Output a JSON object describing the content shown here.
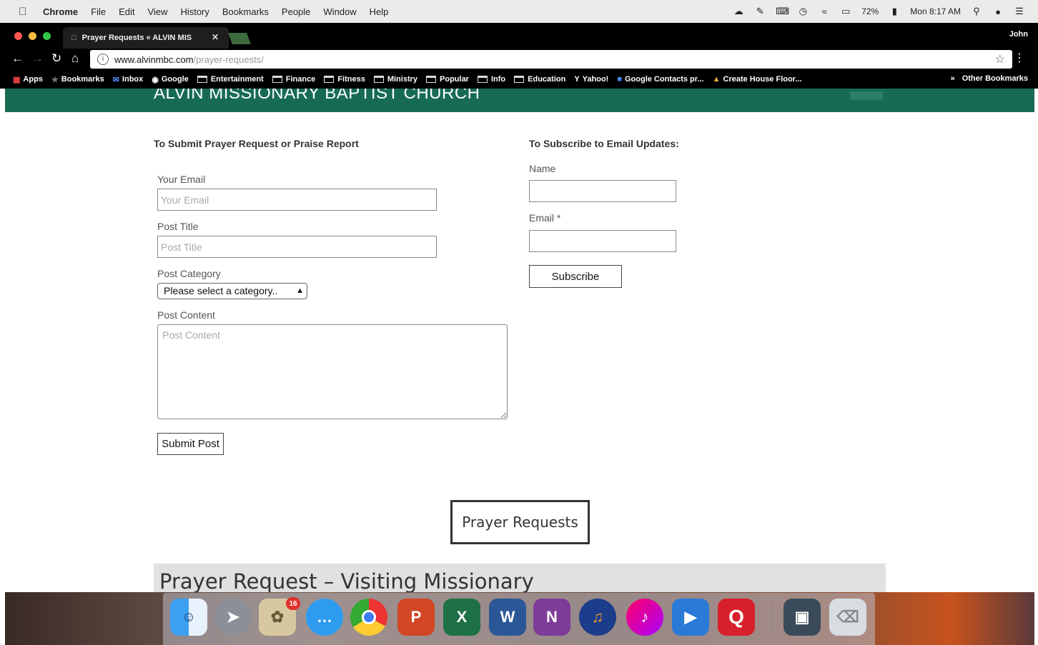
{
  "menubar": {
    "app_name": "Chrome",
    "items": [
      "File",
      "Edit",
      "View",
      "History",
      "Bookmarks",
      "People",
      "Window",
      "Help"
    ],
    "battery": "72%",
    "clock": "Mon 8:17 AM",
    "status_icons": [
      "creative-cloud-icon",
      "script-icon",
      "keyboard-icon",
      "time-machine-icon",
      "wifi-icon",
      "airplay-icon",
      "battery-icon",
      "spotlight-icon",
      "siri-icon",
      "notification-center-icon"
    ]
  },
  "browser": {
    "tab_title": "Prayer Requests « ALVIN MIS",
    "profile": "John",
    "url_host": "www.alvinmbc.com",
    "url_path": "/prayer-requests/",
    "bookmarks": [
      {
        "label": "Apps",
        "icon": "apps-grid-icon"
      },
      {
        "label": "Bookmarks",
        "icon": "star-icon"
      },
      {
        "label": "Inbox",
        "icon": "inbox-icon"
      },
      {
        "label": "Google",
        "icon": "google-icon"
      },
      {
        "label": "Entertainment",
        "icon": "folder-icon"
      },
      {
        "label": "Finance",
        "icon": "folder-icon"
      },
      {
        "label": "Fitness",
        "icon": "folder-icon"
      },
      {
        "label": "Ministry",
        "icon": "folder-icon"
      },
      {
        "label": "Popular",
        "icon": "folder-icon"
      },
      {
        "label": "Info",
        "icon": "folder-icon"
      },
      {
        "label": "Education",
        "icon": "folder-icon"
      },
      {
        "label": "Yahoo!",
        "icon": "yahoo-icon"
      },
      {
        "label": "Google Contacts pr...",
        "icon": "contacts-icon"
      },
      {
        "label": "Create House Floor...",
        "icon": "house-icon"
      }
    ],
    "other_bookmarks": "Other Bookmarks"
  },
  "site": {
    "name": "ALVIN MISSIONARY BAPTIST CHURCH",
    "colors": {
      "header": "#176b55"
    }
  },
  "prayer_form": {
    "title": "To Submit Prayer Request or Praise Report",
    "email_label": "Your Email",
    "email_placeholder": "Your Email",
    "title_label": "Post Title",
    "title_placeholder": "Post Title",
    "category_label": "Post Category",
    "category_selected": "Please select a category..",
    "content_label": "Post Content",
    "content_placeholder": "Post Content",
    "submit_label": "Submit Post"
  },
  "subscribe_form": {
    "title": "To Subscribe to Email Updates:",
    "name_label": "Name",
    "email_label": "Email *",
    "subscribe_label": "Subscribe"
  },
  "prayer_requests_button": "Prayer Requests",
  "latest_post_heading": "Prayer Request – Visiting Missionary",
  "dock": {
    "apps": [
      "finder-icon",
      "launchpad-icon",
      "preview-icon",
      "messages-icon",
      "chrome-icon",
      "powerpoint-icon",
      "excel-icon",
      "word-icon",
      "onenote-icon",
      "audacity-icon",
      "itunes-icon",
      "screen-sharing-icon",
      "quicken-icon",
      "downloads-stack-icon",
      "trash-icon"
    ],
    "badge": "16"
  }
}
